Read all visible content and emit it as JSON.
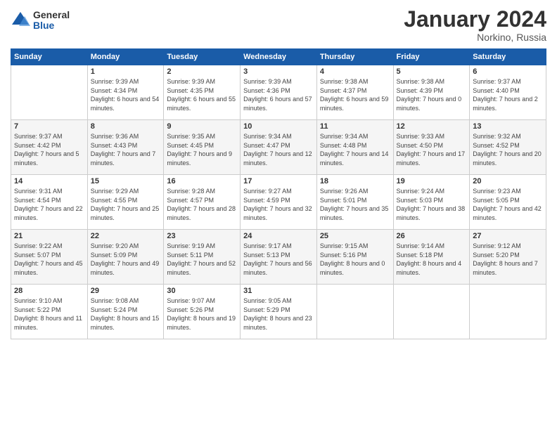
{
  "logo": {
    "general": "General",
    "blue": "Blue"
  },
  "title": "January 2024",
  "location": "Norkino, Russia",
  "days_of_week": [
    "Sunday",
    "Monday",
    "Tuesday",
    "Wednesday",
    "Thursday",
    "Friday",
    "Saturday"
  ],
  "weeks": [
    [
      {
        "day": "",
        "sunrise": "",
        "sunset": "",
        "daylight": ""
      },
      {
        "day": "1",
        "sunrise": "Sunrise: 9:39 AM",
        "sunset": "Sunset: 4:34 PM",
        "daylight": "Daylight: 6 hours and 54 minutes."
      },
      {
        "day": "2",
        "sunrise": "Sunrise: 9:39 AM",
        "sunset": "Sunset: 4:35 PM",
        "daylight": "Daylight: 6 hours and 55 minutes."
      },
      {
        "day": "3",
        "sunrise": "Sunrise: 9:39 AM",
        "sunset": "Sunset: 4:36 PM",
        "daylight": "Daylight: 6 hours and 57 minutes."
      },
      {
        "day": "4",
        "sunrise": "Sunrise: 9:38 AM",
        "sunset": "Sunset: 4:37 PM",
        "daylight": "Daylight: 6 hours and 59 minutes."
      },
      {
        "day": "5",
        "sunrise": "Sunrise: 9:38 AM",
        "sunset": "Sunset: 4:39 PM",
        "daylight": "Daylight: 7 hours and 0 minutes."
      },
      {
        "day": "6",
        "sunrise": "Sunrise: 9:37 AM",
        "sunset": "Sunset: 4:40 PM",
        "daylight": "Daylight: 7 hours and 2 minutes."
      }
    ],
    [
      {
        "day": "7",
        "sunrise": "Sunrise: 9:37 AM",
        "sunset": "Sunset: 4:42 PM",
        "daylight": "Daylight: 7 hours and 5 minutes."
      },
      {
        "day": "8",
        "sunrise": "Sunrise: 9:36 AM",
        "sunset": "Sunset: 4:43 PM",
        "daylight": "Daylight: 7 hours and 7 minutes."
      },
      {
        "day": "9",
        "sunrise": "Sunrise: 9:35 AM",
        "sunset": "Sunset: 4:45 PM",
        "daylight": "Daylight: 7 hours and 9 minutes."
      },
      {
        "day": "10",
        "sunrise": "Sunrise: 9:34 AM",
        "sunset": "Sunset: 4:47 PM",
        "daylight": "Daylight: 7 hours and 12 minutes."
      },
      {
        "day": "11",
        "sunrise": "Sunrise: 9:34 AM",
        "sunset": "Sunset: 4:48 PM",
        "daylight": "Daylight: 7 hours and 14 minutes."
      },
      {
        "day": "12",
        "sunrise": "Sunrise: 9:33 AM",
        "sunset": "Sunset: 4:50 PM",
        "daylight": "Daylight: 7 hours and 17 minutes."
      },
      {
        "day": "13",
        "sunrise": "Sunrise: 9:32 AM",
        "sunset": "Sunset: 4:52 PM",
        "daylight": "Daylight: 7 hours and 20 minutes."
      }
    ],
    [
      {
        "day": "14",
        "sunrise": "Sunrise: 9:31 AM",
        "sunset": "Sunset: 4:54 PM",
        "daylight": "Daylight: 7 hours and 22 minutes."
      },
      {
        "day": "15",
        "sunrise": "Sunrise: 9:29 AM",
        "sunset": "Sunset: 4:55 PM",
        "daylight": "Daylight: 7 hours and 25 minutes."
      },
      {
        "day": "16",
        "sunrise": "Sunrise: 9:28 AM",
        "sunset": "Sunset: 4:57 PM",
        "daylight": "Daylight: 7 hours and 28 minutes."
      },
      {
        "day": "17",
        "sunrise": "Sunrise: 9:27 AM",
        "sunset": "Sunset: 4:59 PM",
        "daylight": "Daylight: 7 hours and 32 minutes."
      },
      {
        "day": "18",
        "sunrise": "Sunrise: 9:26 AM",
        "sunset": "Sunset: 5:01 PM",
        "daylight": "Daylight: 7 hours and 35 minutes."
      },
      {
        "day": "19",
        "sunrise": "Sunrise: 9:24 AM",
        "sunset": "Sunset: 5:03 PM",
        "daylight": "Daylight: 7 hours and 38 minutes."
      },
      {
        "day": "20",
        "sunrise": "Sunrise: 9:23 AM",
        "sunset": "Sunset: 5:05 PM",
        "daylight": "Daylight: 7 hours and 42 minutes."
      }
    ],
    [
      {
        "day": "21",
        "sunrise": "Sunrise: 9:22 AM",
        "sunset": "Sunset: 5:07 PM",
        "daylight": "Daylight: 7 hours and 45 minutes."
      },
      {
        "day": "22",
        "sunrise": "Sunrise: 9:20 AM",
        "sunset": "Sunset: 5:09 PM",
        "daylight": "Daylight: 7 hours and 49 minutes."
      },
      {
        "day": "23",
        "sunrise": "Sunrise: 9:19 AM",
        "sunset": "Sunset: 5:11 PM",
        "daylight": "Daylight: 7 hours and 52 minutes."
      },
      {
        "day": "24",
        "sunrise": "Sunrise: 9:17 AM",
        "sunset": "Sunset: 5:13 PM",
        "daylight": "Daylight: 7 hours and 56 minutes."
      },
      {
        "day": "25",
        "sunrise": "Sunrise: 9:15 AM",
        "sunset": "Sunset: 5:16 PM",
        "daylight": "Daylight: 8 hours and 0 minutes."
      },
      {
        "day": "26",
        "sunrise": "Sunrise: 9:14 AM",
        "sunset": "Sunset: 5:18 PM",
        "daylight": "Daylight: 8 hours and 4 minutes."
      },
      {
        "day": "27",
        "sunrise": "Sunrise: 9:12 AM",
        "sunset": "Sunset: 5:20 PM",
        "daylight": "Daylight: 8 hours and 7 minutes."
      }
    ],
    [
      {
        "day": "28",
        "sunrise": "Sunrise: 9:10 AM",
        "sunset": "Sunset: 5:22 PM",
        "daylight": "Daylight: 8 hours and 11 minutes."
      },
      {
        "day": "29",
        "sunrise": "Sunrise: 9:08 AM",
        "sunset": "Sunset: 5:24 PM",
        "daylight": "Daylight: 8 hours and 15 minutes."
      },
      {
        "day": "30",
        "sunrise": "Sunrise: 9:07 AM",
        "sunset": "Sunset: 5:26 PM",
        "daylight": "Daylight: 8 hours and 19 minutes."
      },
      {
        "day": "31",
        "sunrise": "Sunrise: 9:05 AM",
        "sunset": "Sunset: 5:29 PM",
        "daylight": "Daylight: 8 hours and 23 minutes."
      },
      {
        "day": "",
        "sunrise": "",
        "sunset": "",
        "daylight": ""
      },
      {
        "day": "",
        "sunrise": "",
        "sunset": "",
        "daylight": ""
      },
      {
        "day": "",
        "sunrise": "",
        "sunset": "",
        "daylight": ""
      }
    ]
  ]
}
